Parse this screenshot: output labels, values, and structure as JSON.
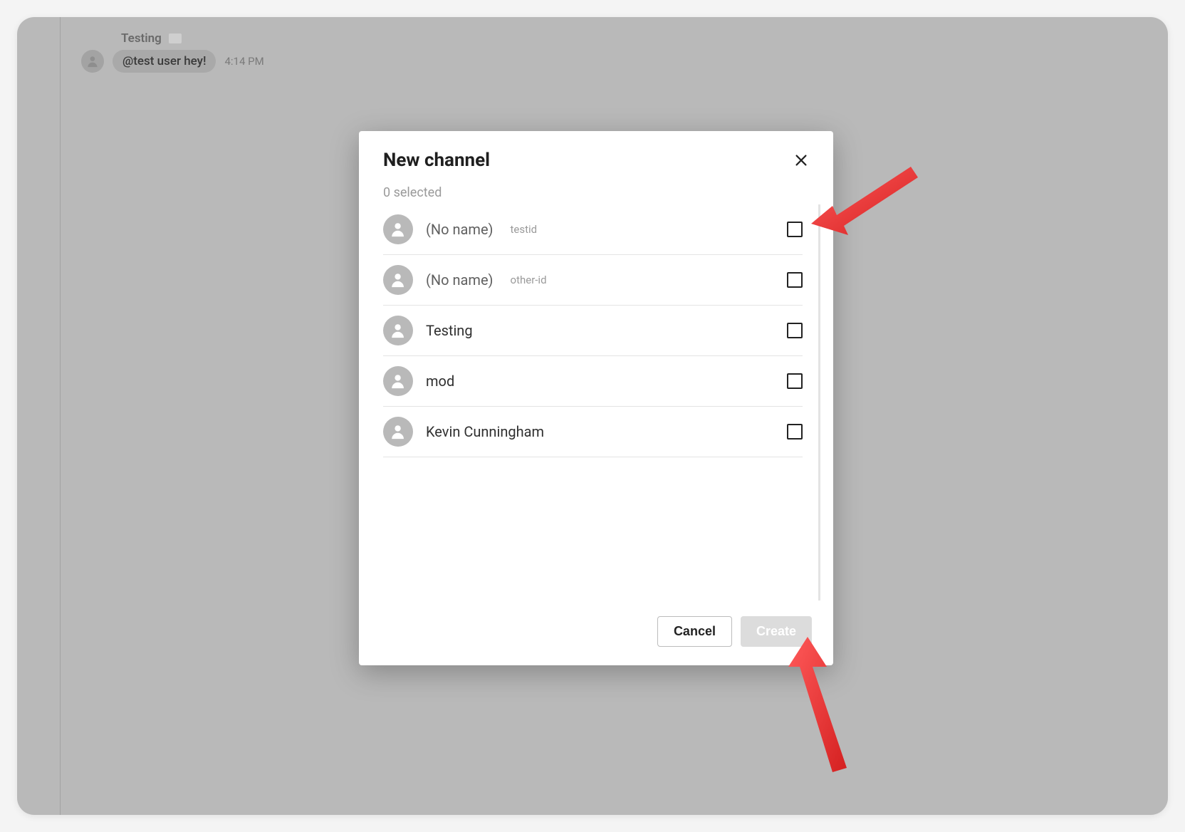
{
  "chat": {
    "sender": "Testing",
    "message": "@test user hey!",
    "time": "4:14 PM"
  },
  "modal": {
    "title": "New channel",
    "selected_text": "0 selected",
    "users": [
      {
        "name": "(No name)",
        "sub": "testid",
        "muted": true
      },
      {
        "name": "(No name)",
        "sub": "other-id",
        "muted": true
      },
      {
        "name": "Testing",
        "sub": "",
        "muted": false
      },
      {
        "name": "mod",
        "sub": "",
        "muted": false
      },
      {
        "name": "Kevin Cunningham",
        "sub": "",
        "muted": false
      }
    ],
    "cancel_label": "Cancel",
    "create_label": "Create"
  }
}
